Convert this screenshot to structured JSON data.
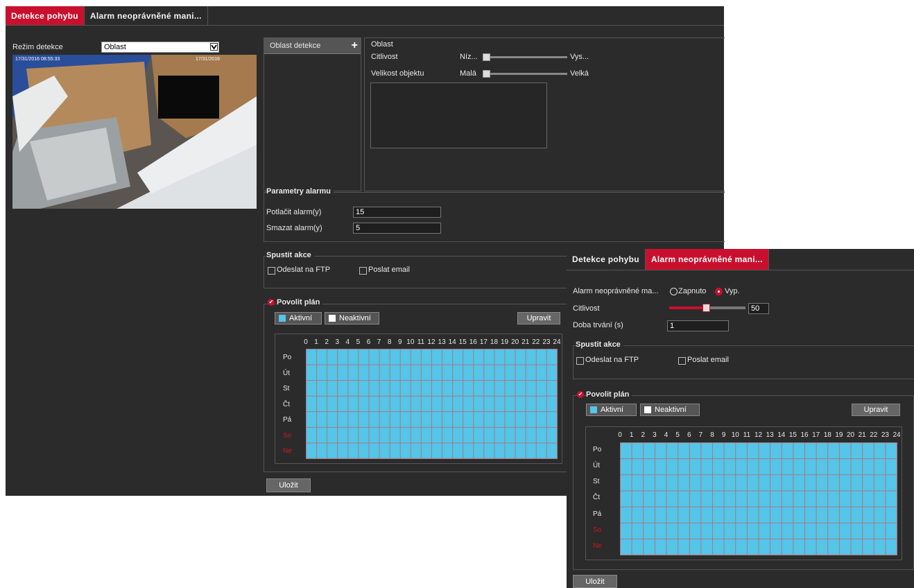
{
  "motion": {
    "tabs": [
      {
        "label": "Detekce pohybu",
        "active": true
      },
      {
        "label": "Alarm neoprávněné mani...",
        "active": false
      }
    ],
    "mode_label": "Režim detekce",
    "mode_value": "Oblast",
    "video": {
      "ts_left": "17/31/2016 08:55:33",
      "ts_right": "17/31/2016"
    },
    "area_list_title": "Oblast detekce",
    "area": {
      "title": "Oblast",
      "sensitivity_label": "Citlivost",
      "sensitivity_min": "Níz...",
      "sensitivity_max": "Vys...",
      "size_label": "Velikost objektu",
      "size_min": "Malá",
      "size_max": "Velká"
    },
    "alarm_params": {
      "title": "Parametry alarmu",
      "suppress_label": "Potlačit alarm(y)",
      "suppress_value": "15",
      "clear_label": "Smazat alarm(y)",
      "clear_value": "5"
    },
    "actions": {
      "title": "Spustit akce",
      "ftp": "Odeslat na FTP",
      "email": "Poslat email"
    },
    "schedule": {
      "title": "Povolit plán",
      "active": "Aktivní",
      "inactive": "Neaktivní",
      "edit": "Upravit",
      "days": [
        "Po",
        "Út",
        "St",
        "Čt",
        "Pá",
        "So",
        "Ne"
      ],
      "hours": [
        "0",
        "1",
        "2",
        "3",
        "4",
        "5",
        "6",
        "7",
        "8",
        "9",
        "10",
        "11",
        "12",
        "13",
        "14",
        "15",
        "16",
        "17",
        "18",
        "19",
        "20",
        "21",
        "22",
        "23",
        "24"
      ]
    },
    "save": "Uložit"
  },
  "tamper": {
    "tabs": [
      {
        "label": "Detekce pohybu",
        "active": false
      },
      {
        "label": "Alarm neoprávněné mani...",
        "active": true
      }
    ],
    "enable_label": "Alarm neoprávněné ma...",
    "on_label": "Zapnuto",
    "off_label": "Vyp.",
    "sensitivity_label": "Citlivost",
    "sensitivity_value": "50",
    "duration_label": "Doba trvání (s)",
    "duration_value": "1",
    "actions": {
      "title": "Spustit akce",
      "ftp": "Odeslat na FTP",
      "email": "Poslat email"
    },
    "schedule": {
      "title": "Povolit plán",
      "active": "Aktivní",
      "inactive": "Neaktivní",
      "edit": "Upravit",
      "days": [
        "Po",
        "Út",
        "St",
        "Čt",
        "Pá",
        "So",
        "Ne"
      ],
      "hours": [
        "0",
        "1",
        "2",
        "3",
        "4",
        "5",
        "6",
        "7",
        "8",
        "9",
        "10",
        "11",
        "12",
        "13",
        "14",
        "15",
        "16",
        "17",
        "18",
        "19",
        "20",
        "21",
        "22",
        "23",
        "24"
      ]
    },
    "save": "Uložit"
  },
  "colors": {
    "accent": "#c8102e",
    "grid": "#55c5e8",
    "panel": "#2b2b2b",
    "weekend": "#d0161b"
  }
}
